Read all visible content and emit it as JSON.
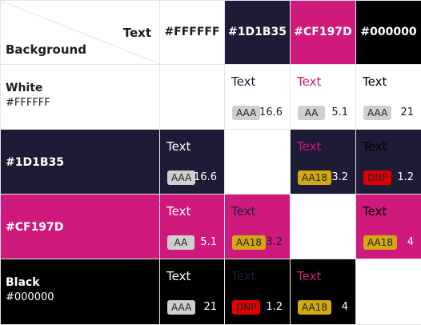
{
  "header": {
    "text_label": "Text",
    "background_label": "Background"
  },
  "columns": [
    {
      "label": "#FFFFFF",
      "bg": "#FFFFFF",
      "fg": "#1e1e1e"
    },
    {
      "label": "#1D1B35",
      "bg": "#1D1B35",
      "fg": "#ffffff"
    },
    {
      "label": "#CF197D",
      "bg": "#CF197D",
      "fg": "#ffffff"
    },
    {
      "label": "#000000",
      "bg": "#000000",
      "fg": "#ffffff"
    }
  ],
  "rows": [
    {
      "name": "White",
      "hex": "#FFFFFF",
      "bg": "#FFFFFF",
      "fg": "#1e1e1e",
      "cells": [
        null,
        {
          "sample": "Text",
          "rating": "AAA",
          "ratio": "16.6",
          "text_color": "#1D1B35",
          "ratio_color": "#1e1e1e"
        },
        {
          "sample": "Text",
          "rating": "AA",
          "ratio": "5.1",
          "text_color": "#CF197D",
          "ratio_color": "#1e1e1e"
        },
        {
          "sample": "Text",
          "rating": "AAA",
          "ratio": "21",
          "text_color": "#000000",
          "ratio_color": "#1e1e1e"
        }
      ]
    },
    {
      "name": "#1D1B35",
      "hex": "",
      "bg": "#1D1B35",
      "fg": "#ffffff",
      "cells": [
        {
          "sample": "Text",
          "rating": "AAA",
          "ratio": "16.6",
          "text_color": "#FFFFFF",
          "ratio_color": "#ffffff"
        },
        null,
        {
          "sample": "Text",
          "rating": "AA18",
          "ratio": "3.2",
          "text_color": "#CF197D",
          "ratio_color": "#ffffff"
        },
        {
          "sample": "Text",
          "rating": "DNP",
          "ratio": "1.2",
          "text_color": "#000000",
          "ratio_color": "#ffffff"
        }
      ]
    },
    {
      "name": "#CF197D",
      "hex": "",
      "bg": "#CF197D",
      "fg": "#ffffff",
      "cells": [
        {
          "sample": "Text",
          "rating": "AA",
          "ratio": "5.1",
          "text_color": "#FFFFFF",
          "ratio_color": "#ffffff"
        },
        {
          "sample": "Text",
          "rating": "AA18",
          "ratio": "3.2",
          "text_color": "#1D1B35",
          "ratio_color": "#1D1B35"
        },
        null,
        {
          "sample": "Text",
          "rating": "AA18",
          "ratio": "4",
          "text_color": "#000000",
          "ratio_color": "#ffffff"
        }
      ]
    },
    {
      "name": "Black",
      "hex": "#000000",
      "bg": "#000000",
      "fg": "#ffffff",
      "cells": [
        {
          "sample": "Text",
          "rating": "AAA",
          "ratio": "21",
          "text_color": "#FFFFFF",
          "ratio_color": "#ffffff"
        },
        {
          "sample": "Text",
          "rating": "DNP",
          "ratio": "1.2",
          "text_color": "#1D1B35",
          "ratio_color": "#ffffff"
        },
        {
          "sample": "Text",
          "rating": "AA18",
          "ratio": "4",
          "text_color": "#CF197D",
          "ratio_color": "#ffffff"
        },
        null
      ]
    }
  ]
}
